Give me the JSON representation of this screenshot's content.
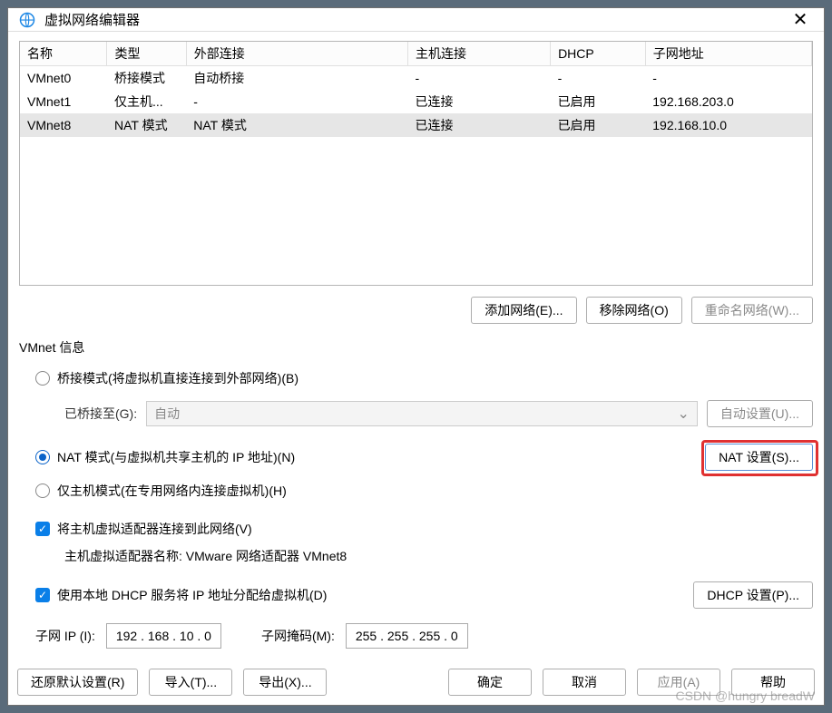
{
  "title": "虚拟网络编辑器",
  "table": {
    "headers": [
      "名称",
      "类型",
      "外部连接",
      "主机连接",
      "DHCP",
      "子网地址"
    ],
    "rows": [
      {
        "name": "VMnet0",
        "type": "桥接模式",
        "ext": "自动桥接",
        "host": "-",
        "dhcp": "-",
        "subnet": "-",
        "selected": false
      },
      {
        "name": "VMnet1",
        "type": "仅主机...",
        "ext": "-",
        "host": "已连接",
        "dhcp": "已启用",
        "subnet": "192.168.203.0",
        "selected": false
      },
      {
        "name": "VMnet8",
        "type": "NAT 模式",
        "ext": "NAT 模式",
        "host": "已连接",
        "dhcp": "已启用",
        "subnet": "192.168.10.0",
        "selected": true
      }
    ]
  },
  "buttons": {
    "add_net": "添加网络(E)...",
    "remove_net": "移除网络(O)",
    "rename_net": "重命名网络(W)...",
    "auto_bridge": "自动设置(U)...",
    "nat_settings": "NAT 设置(S)...",
    "dhcp_settings": "DHCP 设置(P)...",
    "restore": "还原默认设置(R)",
    "import": "导入(T)...",
    "export": "导出(X)...",
    "ok": "确定",
    "cancel": "取消",
    "apply": "应用(A)",
    "help": "帮助"
  },
  "group": {
    "title": "VMnet 信息",
    "bridge_label": "桥接模式(将虚拟机直接连接到外部网络)(B)",
    "bridge_to": "已桥接至(G):",
    "bridge_value": "自动",
    "nat_label": "NAT 模式(与虚拟机共享主机的 IP 地址)(N)",
    "hostonly_label": "仅主机模式(在专用网络内连接虚拟机)(H)",
    "host_adapter_check": "将主机虚拟适配器连接到此网络(V)",
    "host_adapter_name": "主机虚拟适配器名称: VMware 网络适配器 VMnet8",
    "dhcp_check": "使用本地 DHCP 服务将 IP 地址分配给虚拟机(D)",
    "subnet_ip_label": "子网 IP (I):",
    "subnet_ip": "192 . 168 . 10  .  0",
    "subnet_mask_label": "子网掩码(M):",
    "subnet_mask": "255 . 255 . 255 .  0"
  },
  "watermark": "CSDN @hungry breadW"
}
